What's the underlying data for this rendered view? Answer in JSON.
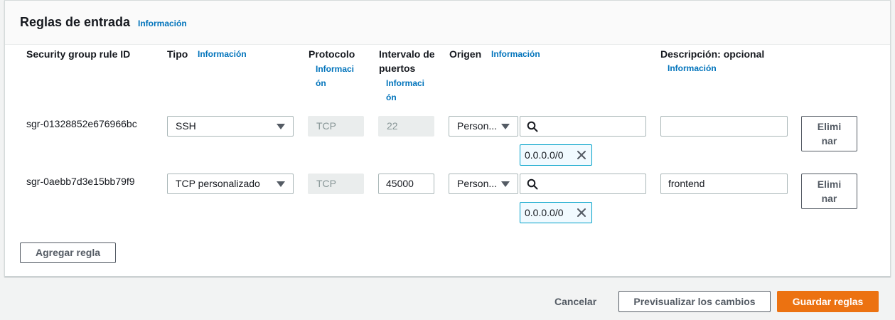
{
  "panel": {
    "title": "Reglas de entrada",
    "title_info": "Información"
  },
  "columns": {
    "rule_id": "Security group rule ID",
    "type": "Tipo",
    "type_info": "Información",
    "protocol": "Protocolo",
    "protocol_info": "Información",
    "port_range": "Intervalo de puertos",
    "port_range_info": "Información",
    "source": "Origen",
    "source_info": "Información",
    "description": "Descripción: opcional",
    "description_info": "Información"
  },
  "rules": [
    {
      "id": "sgr-01328852e676966bc",
      "type": "SSH",
      "protocol": "TCP",
      "port": "22",
      "source_type": "Person...",
      "search_value": "",
      "cidr": "0.0.0.0/0",
      "description": "",
      "delete_label": "Eliminar"
    },
    {
      "id": "sgr-0aebb7d3e15bb79f9",
      "type": "TCP personalizado",
      "protocol": "TCP",
      "port": "45000",
      "source_type": "Person...",
      "search_value": "",
      "cidr": "0.0.0.0/0",
      "description": "frontend",
      "delete_label": "Eliminar"
    }
  ],
  "add_rule_label": "Agregar regla",
  "footer": {
    "cancel": "Cancelar",
    "preview": "Previsualizar los cambios",
    "save": "Guardar reglas"
  },
  "colors": {
    "accent_link": "#0073bb",
    "primary_button": "#ec7211",
    "token_border": "#00a1c9"
  }
}
